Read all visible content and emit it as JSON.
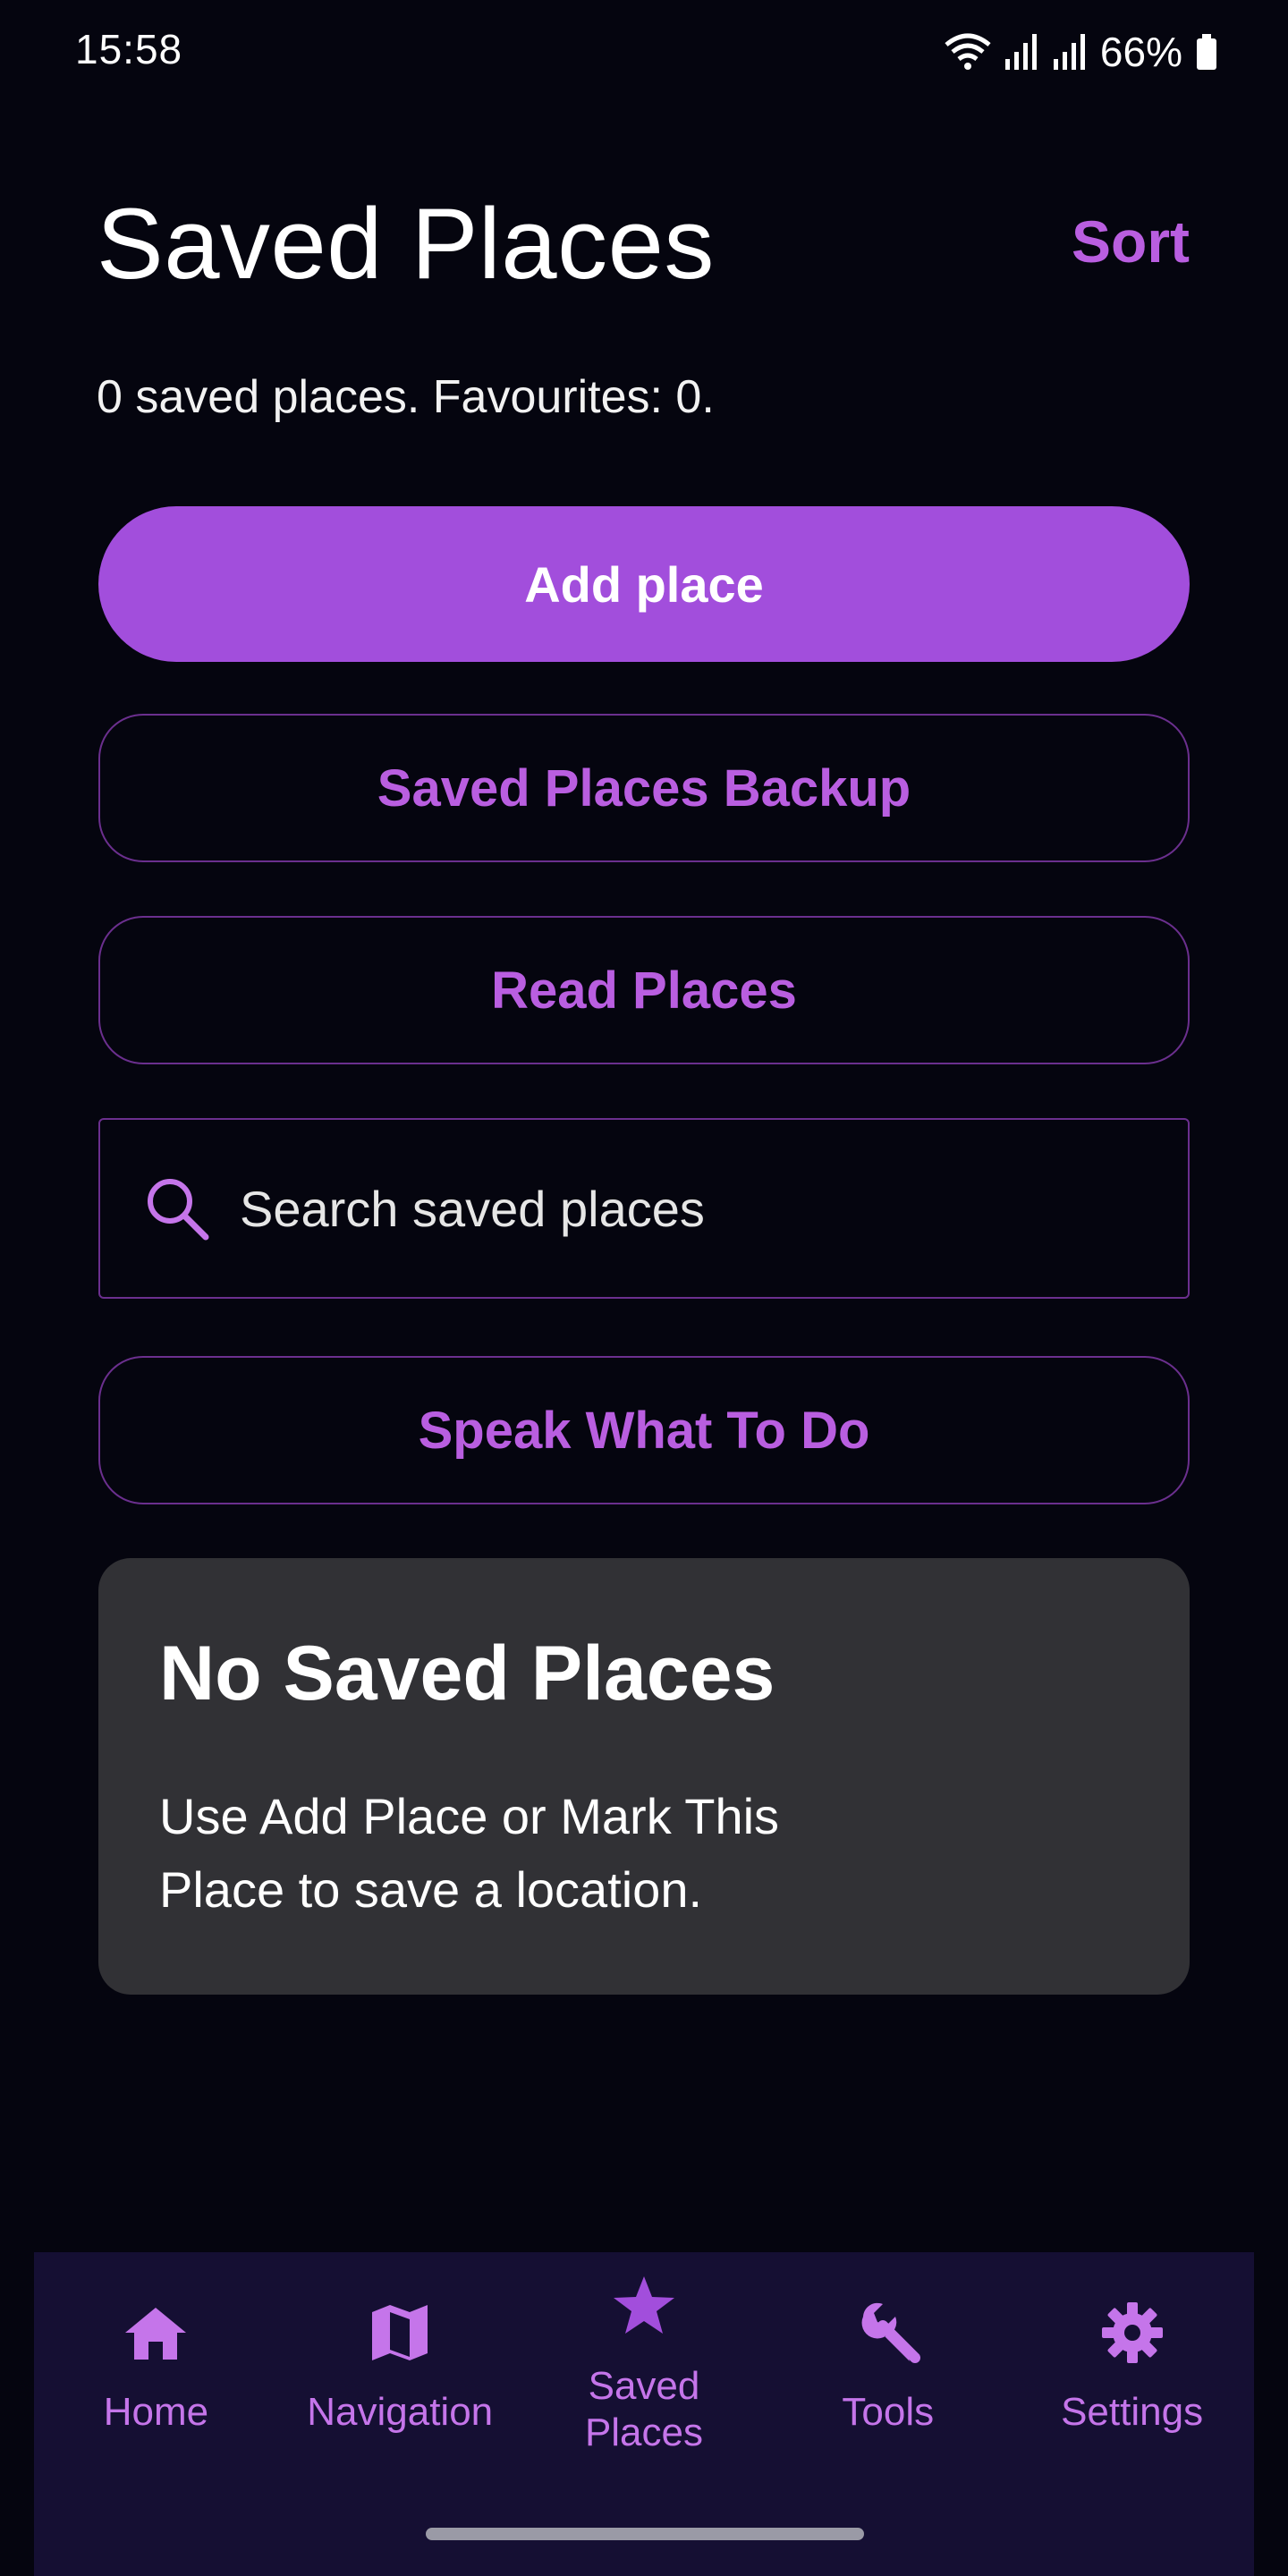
{
  "status_bar": {
    "time": "15:58",
    "battery": "66%",
    "icons": [
      "wifi-icon",
      "signal-icon",
      "signal-icon",
      "battery-icon"
    ]
  },
  "header": {
    "title": "Saved Places",
    "sort_label": "Sort",
    "summary": "0 saved places. Favourites: 0."
  },
  "actions": {
    "add_place": "Add place",
    "backup": "Saved Places Backup",
    "read_places": "Read Places",
    "speak": "Speak What To Do"
  },
  "search": {
    "placeholder": "Search saved places",
    "value": ""
  },
  "empty_state": {
    "title": "No Saved Places",
    "message": "Use Add Place or Mark This Place to save a location."
  },
  "bottom_nav": {
    "items": [
      {
        "label": "Home",
        "icon": "home-icon"
      },
      {
        "label": "Navigation",
        "icon": "map-icon"
      },
      {
        "label": "Saved Places",
        "icon": "star-icon",
        "active": true
      },
      {
        "label": "Tools",
        "icon": "wrench-icon"
      },
      {
        "label": "Settings",
        "icon": "gear-icon"
      }
    ]
  },
  "colors": {
    "background": "#05050f",
    "accent": "#a24edc",
    "accent_text": "#b95ee0",
    "outline": "#6b2f8e",
    "card": "#313135",
    "nav_background": "#150f33"
  }
}
